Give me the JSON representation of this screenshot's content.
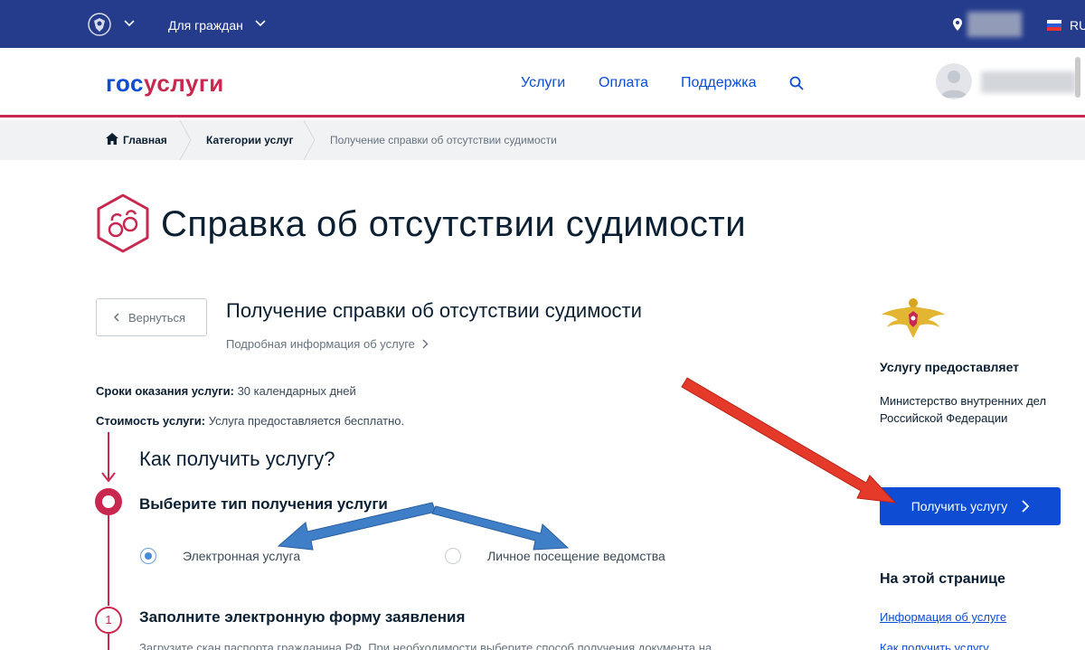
{
  "topbar": {
    "citizens_label": "Для граждан",
    "lang": "RU"
  },
  "header": {
    "logo_part1": "гос",
    "logo_part2": "услуги",
    "nav": [
      "Услуги",
      "Оплата",
      "Поддержка"
    ]
  },
  "breadcrumbs": [
    "Главная",
    "Категории услуг",
    "Получение справки об отсутствии судимости"
  ],
  "page": {
    "title": "Справка об отсутствии судимости",
    "back_label": "Вернуться",
    "service_title": "Получение справки об отсутствии судимости",
    "more_info": "Подробная информация об услуге",
    "terms_label": "Сроки оказания услуги:",
    "terms_value": " 30 календарных дней",
    "cost_label": "Стоимость услуги:",
    "cost_value": " Услуга предоставляется бесплатно."
  },
  "how": {
    "title": "Как получить услугу?",
    "step1_title": "Выберите тип получения услуги",
    "option_electronic": "Электронная услуга",
    "option_personal": "Личное посещение ведомства",
    "selected": "electronic",
    "step2_number": "1",
    "step2_title": "Заполните электронную форму заявления",
    "step2_text": "Загрузите скан паспорта гражданина РФ. При необходимости выберите способ получения документа на"
  },
  "sidebar": {
    "provider_title": "Услугу предоставляет",
    "provider_name": "Министерство внутренних дел Российской Федерации",
    "get_button": "Получить услугу",
    "on_page_title": "На этой странице",
    "links": [
      "Информация об услуге",
      "Как получить услугу"
    ]
  },
  "colors": {
    "topbar": "#253c8c",
    "brand_blue": "#0d4cd3",
    "brand_red": "#c8284f",
    "arrow_red": "#e53a2a",
    "arrow_blue": "#3f7fc8"
  }
}
